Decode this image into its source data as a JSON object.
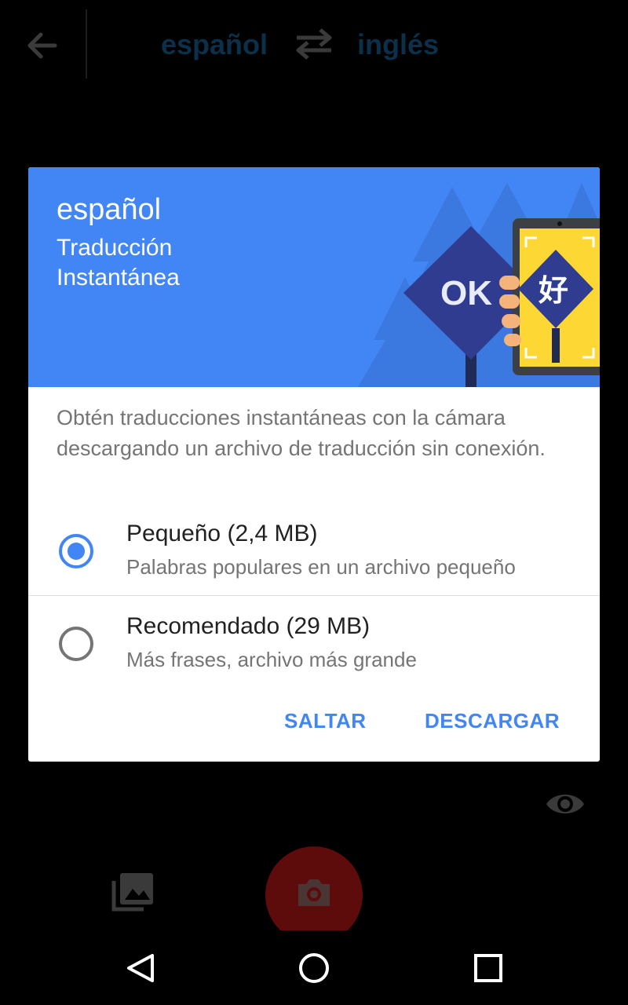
{
  "topbar": {
    "source_language": "español",
    "target_language": "inglés",
    "back_icon": "arrow-left-icon",
    "swap_icon": "swap-arrows-icon"
  },
  "dialog": {
    "banner_language": "español",
    "banner_subtitle": "Traducción Instantánea",
    "illustration": {
      "sign_text": "OK",
      "phone_text": "好"
    },
    "description": "Obtén traducciones instantáneas con la cámara descargando un archivo de traducción sin conexión.",
    "options": [
      {
        "title": "Pequeño (2,4 MB)",
        "subtitle": "Palabras populares en un archivo pequeño",
        "selected": true
      },
      {
        "title": "Recomendado (29 MB)",
        "subtitle": "Más frases, archivo más grande",
        "selected": false
      }
    ],
    "skip_label": "SALTAR",
    "download_label": "DESCARGAR"
  },
  "colors": {
    "accent": "#4285f4",
    "scrim_background": "#000000",
    "shutter": "#5e0b0b"
  },
  "icons": {
    "eye": "eye-icon",
    "gallery": "gallery-icon",
    "camera": "camera-icon",
    "nav_back": "nav-back-triangle-icon",
    "nav_home": "nav-home-circle-icon",
    "nav_recent": "nav-recent-square-icon"
  }
}
